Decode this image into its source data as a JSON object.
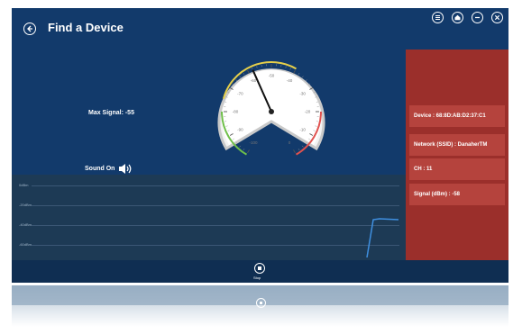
{
  "header": {
    "title": "Find a Device"
  },
  "window_buttons": [
    "menu-icon",
    "home-icon",
    "minimize-icon",
    "close-icon"
  ],
  "max_signal": "Max Signal: -55",
  "sound_label": "Sound On",
  "gauge": {
    "ticks": [
      "-100",
      "-90",
      "-80",
      "-70",
      "-60",
      "-50",
      "-40",
      "-30",
      "-20",
      "-10",
      "0"
    ],
    "reading": -58
  },
  "info_panel": {
    "device": "Device : 68:8D:AB:D2:37:C1",
    "network": "Network (SSID) : DanaherTM",
    "channel": "CH : 11",
    "signal": "Signal (dBm) : -58"
  },
  "chart": {
    "y_ticks": [
      "0dBm",
      "-20dBm",
      "-40dBm",
      "-60dBm"
    ]
  },
  "stop_label": "Stop",
  "colors": {
    "background": "#123a6b",
    "panel": "#9b2f2b",
    "panel_item": "#b5433d",
    "chart_bg": "#1d3a55",
    "signal_line": "#3f8fe0"
  }
}
